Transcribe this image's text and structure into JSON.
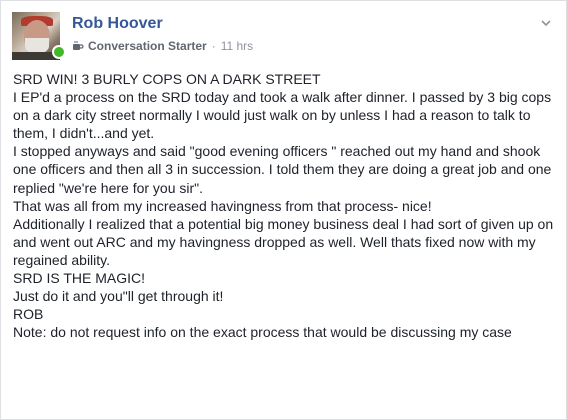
{
  "post": {
    "author": "Rob Hoover",
    "badge_icon": "coffee-cup-icon",
    "badge": "Conversation Starter",
    "separator": "·",
    "timestamp": "11 hrs",
    "online": true,
    "colors": {
      "author": "#365899",
      "meta": "#90949c",
      "online": "#42b72a",
      "text": "#1d2129"
    },
    "lines": [
      "SRD WIN! 3 BURLY COPS ON A DARK STREET",
      "I EP'd a process on the SRD today and took a walk after dinner. I passed by 3 big cops on a dark city street normally I would just walk on by unless I had a reason to talk to them, I didn't...and yet.",
      "I stopped anyways and said \"good evening officers \" reached out my hand and shook one officers and then all 3 in succession. I told them they are doing a great job and one replied \"we're here for you sir\".",
      "That was all from my increased havingness from that process- nice!",
      "Additionally I realized that a potential big money business deal I had sort of given up on and went out ARC and my havingness dropped as well. Well thats fixed now with my regained ability.",
      "SRD IS THE MAGIC!",
      "Just do it and you\"ll get through it!",
      "ROB",
      "Note: do not request info on the exact process that would be discussing my case"
    ]
  }
}
